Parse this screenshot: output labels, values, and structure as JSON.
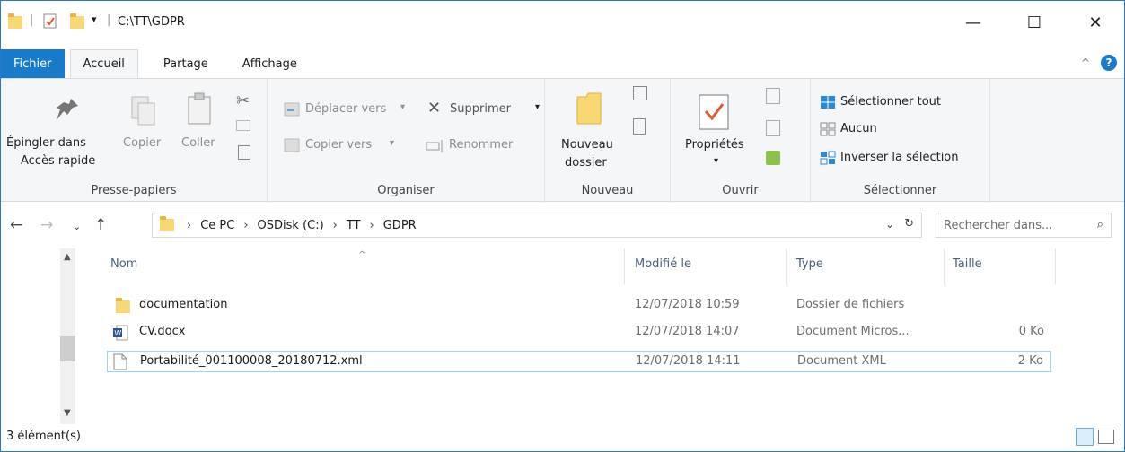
{
  "window": {
    "title": "C:\\TT\\GDPR",
    "controls": {
      "minimize": "—",
      "maximize": "☐",
      "close": "✕"
    }
  },
  "tabs": [
    {
      "label": "Fichier"
    },
    {
      "label": "Accueil"
    },
    {
      "label": "Partage"
    },
    {
      "label": "Affichage"
    }
  ],
  "ribbon": {
    "clipboard": {
      "label": "Presse-papiers",
      "pin_line1": "Épingler dans",
      "pin_line2": "Accès rapide",
      "copy": "Copier",
      "paste": "Coller"
    },
    "organize": {
      "label": "Organiser",
      "move_to": "Déplacer vers",
      "copy_to": "Copier vers",
      "delete": "Supprimer",
      "rename": "Renommer"
    },
    "new": {
      "label": "Nouveau",
      "new_folder_line1": "Nouveau",
      "new_folder_line2": "dossier"
    },
    "open": {
      "label": "Ouvrir",
      "properties": "Propriétés"
    },
    "select": {
      "label": "Sélectionner",
      "select_all": "Sélectionner tout",
      "select_none": "Aucun",
      "invert": "Inverser la sélection"
    }
  },
  "address": {
    "crumbs": [
      "Ce PC",
      "OSDisk (C:)",
      "TT",
      "GDPR"
    ],
    "search_placeholder": "Rechercher dans..."
  },
  "columns": {
    "name": "Nom",
    "modified": "Modifié le",
    "type": "Type",
    "size": "Taille"
  },
  "files": [
    {
      "name": "documentation",
      "modified": "12/07/2018 10:59",
      "type": "Dossier de fichiers",
      "size": "",
      "icon": "folder-icon"
    },
    {
      "name": "CV.docx",
      "modified": "12/07/2018 14:07",
      "type": "Document Micros...",
      "size": "0 Ko",
      "icon": "word-doc-icon"
    },
    {
      "name": "Portabilité_001100008_20180712.xml",
      "modified": "12/07/2018 14:11",
      "type": "Document XML",
      "size": "2 Ko",
      "icon": "xml-file-icon"
    }
  ],
  "status": {
    "count": "3 élément(s)"
  },
  "colors": {
    "accent": "#1979ca",
    "selection_border": "#99d1ff"
  }
}
